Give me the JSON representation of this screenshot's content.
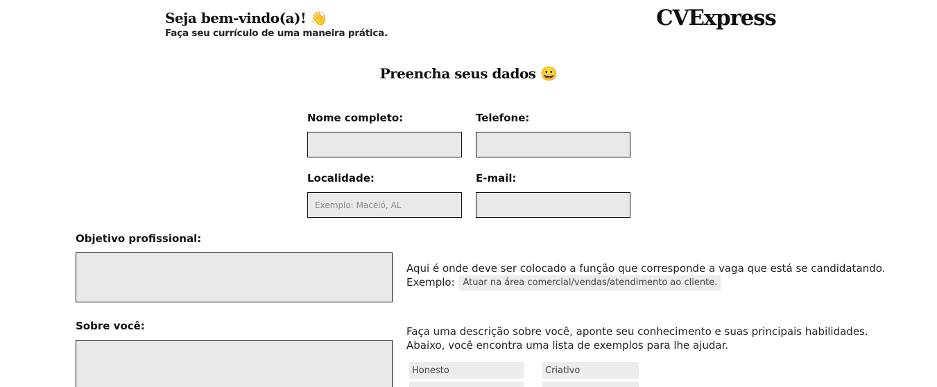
{
  "header": {
    "welcome_title": "Seja bem-vindo(a)!",
    "welcome_emoji": "👋",
    "welcome_subtitle": "Faça seu currículo de uma maneira prática.",
    "logo": "CVExpress"
  },
  "form": {
    "title": "Preencha seus dados",
    "title_emoji": "😀",
    "name_label": "Nome completo:",
    "phone_label": "Telefone:",
    "location_label": "Localidade:",
    "location_placeholder": "Exemplo: Maceió, AL",
    "email_label": "E-mail:",
    "objective_label": "Objetivo profissional:",
    "objective_help": "Aqui é onde deve ser colocado a função que corresponde a vaga que está se candidatando.",
    "objective_example_label": "Exemplo:",
    "objective_example": "Atuar na área comercial/vendas/atendimento ao cliente.",
    "about_label": "Sobre você:",
    "about_help_1": "Faça uma descrição sobre você, aponte seu conhecimento e suas principais habilidades.",
    "about_help_2": "Abaixo, você encontra uma lista de exemplos para lhe ajudar.",
    "traits": [
      "Honesto",
      "Criativo"
    ]
  }
}
